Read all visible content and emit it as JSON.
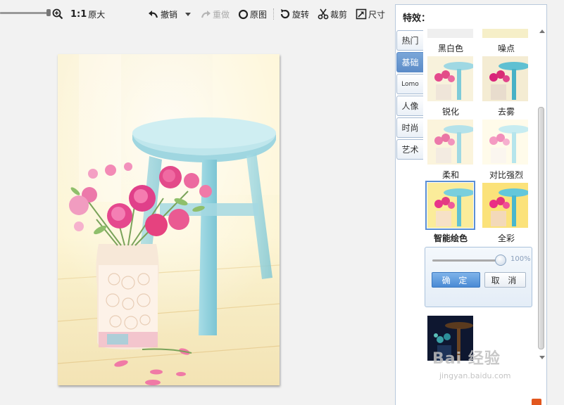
{
  "toolbar": {
    "ratio": "1:1",
    "original_size": "原大",
    "undo": "撤销",
    "redo": "重做",
    "original_image": "原图",
    "rotate": "旋转",
    "crop": "裁剪",
    "resize": "尺寸"
  },
  "panel": {
    "title": "特效：",
    "tabs": [
      "热门",
      "基础",
      "Lomo",
      "人像",
      "时尚",
      "艺术"
    ],
    "active_tab": "基础",
    "effects": [
      {
        "label": "黑白色"
      },
      {
        "label": "噪点"
      },
      {
        "label": "锐化"
      },
      {
        "label": "去雾"
      },
      {
        "label": "柔和"
      },
      {
        "label": "对比强烈"
      },
      {
        "label": "智能绘色",
        "selected": true
      },
      {
        "label": "全彩"
      }
    ],
    "intensity": {
      "value_text": "100%",
      "value": 1.0
    },
    "confirm": "确 定",
    "cancel": "取 消"
  },
  "watermark": {
    "logo": "Bai 经验",
    "url": "jingyan.baidu.com"
  },
  "colors": {
    "accent": "#5b8fd4",
    "panel_border": "#b9c9dc"
  }
}
